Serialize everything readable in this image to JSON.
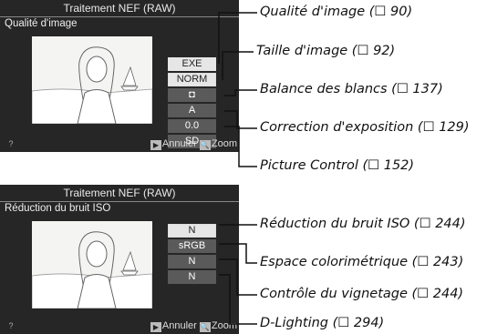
{
  "top_screen": {
    "title": "Traitement NEF (RAW)",
    "subtitle": "Qualité d'image",
    "options": [
      "EXE",
      "NORM",
      "◘",
      "A",
      "0.0",
      "SD"
    ],
    "help": "?",
    "cancel": "Annuler",
    "zoom": "Zoom"
  },
  "bottom_screen": {
    "title": "Traitement NEF (RAW)",
    "subtitle": "Réduction du bruit ISO",
    "options": [
      "N",
      "sRGB",
      "N",
      "N"
    ],
    "help": "?",
    "cancel": "Annuler",
    "zoom": "Zoom"
  },
  "callouts_top": [
    "Qualité d'image (☐ 90)",
    "Taille d'image (☐ 92)",
    "Balance des blancs (☐ 137)",
    "Correction d'exposition (☐ 129)",
    "Picture Control (☐ 152)"
  ],
  "callouts_bottom": [
    "Réduction du bruit ISO (☐ 244)",
    "Espace colorimétrique (☐ 243)",
    "Contrôle du vignetage (☐ 244)",
    "D-Lighting (☐ 294)"
  ]
}
